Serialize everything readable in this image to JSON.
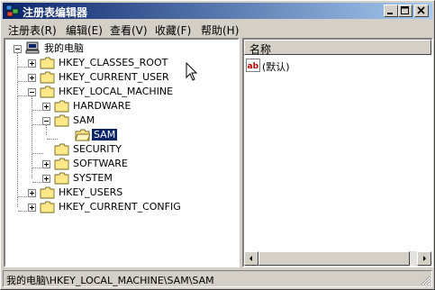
{
  "window": {
    "title": "注册表编辑器",
    "controls": {
      "minimize": "minimize",
      "maximize": "maximize",
      "close": "close"
    }
  },
  "menubar": {
    "items": [
      "注册表(R)",
      "编辑(E)",
      "查看(V)",
      "收藏(F)",
      "帮助(H)"
    ]
  },
  "tree": {
    "root": "我的电脑",
    "hkcr": "HKEY_CLASSES_ROOT",
    "hkcu": "HKEY_CURRENT_USER",
    "hklm": "HKEY_LOCAL_MACHINE",
    "hardware": "HARDWARE",
    "sam": "SAM",
    "sam_sub": "SAM",
    "security": "SECURITY",
    "software": "SOFTWARE",
    "system": "SYSTEM",
    "hku": "HKEY_USERS",
    "hkcc": "HKEY_CURRENT_CONFIG"
  },
  "list": {
    "column_name": "名称",
    "default_value": "(默认)",
    "value_icon_text": "ab"
  },
  "status": {
    "path": "我的电脑\\HKEY_LOCAL_MACHINE\\SAM\\SAM"
  },
  "colors": {
    "titlebar_start": "#0a246a",
    "titlebar_end": "#a6caf0",
    "selection": "#0a246a",
    "folder": "#ffe88c"
  }
}
